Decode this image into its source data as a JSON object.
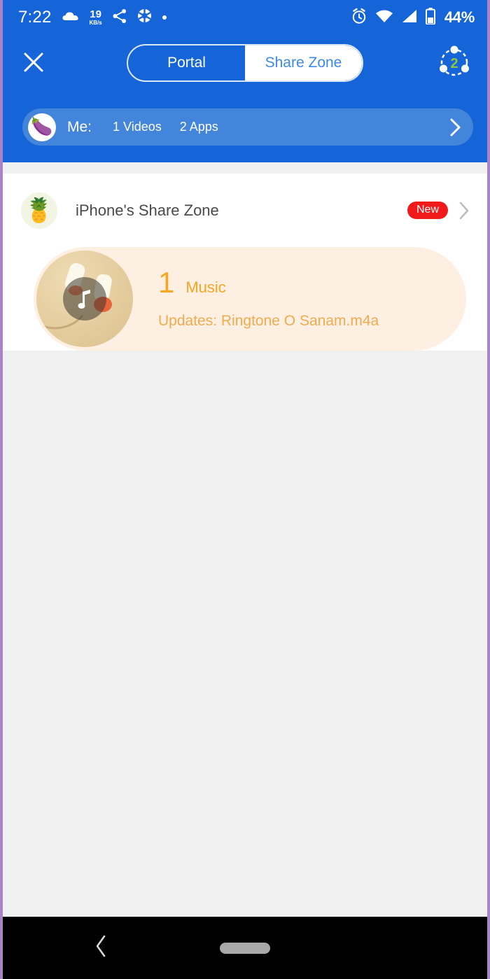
{
  "status_bar": {
    "time": "7:22",
    "network_speed_value": "19",
    "network_speed_unit": "KB/s",
    "battery_percent": "44%",
    "icons": [
      "cloud-icon",
      "share-icon",
      "aperture-icon",
      "dot-icon",
      "alarm-icon",
      "wifi-icon",
      "signal-icon",
      "battery-icon"
    ]
  },
  "header": {
    "close_icon": "close-icon",
    "tabs": [
      {
        "label": "Portal",
        "active": false
      },
      {
        "label": "Share Zone",
        "active": true
      }
    ],
    "connection_badge_count": "2",
    "me_row": {
      "avatar_glyph": "🍆",
      "label": "Me:",
      "stats": [
        "1 Videos",
        "2 Apps"
      ],
      "chevron_icon": "chevron-right-icon"
    }
  },
  "zone": {
    "avatar_glyph": "🍍",
    "title": "iPhone's Share Zone",
    "badge": "New",
    "chevron_icon": "chevron-right-icon",
    "media": {
      "count": "1",
      "type": "Music",
      "updates": "Updates: Ringtone O Sanam.m4a",
      "thumb_icon": "music-note-icon"
    }
  },
  "bottom_nav": {
    "back_icon": "back-chevron-icon",
    "home_icon": "home-pill-icon"
  },
  "colors": {
    "header_blue": "#1565d8",
    "me_row_blue": "#4485dc",
    "accent_orange": "#f5a623",
    "badge_red": "#f01a1a",
    "badge_green": "#8cc63f",
    "card_cream": "#fdf0e3",
    "page_gray": "#f0f0f0"
  }
}
